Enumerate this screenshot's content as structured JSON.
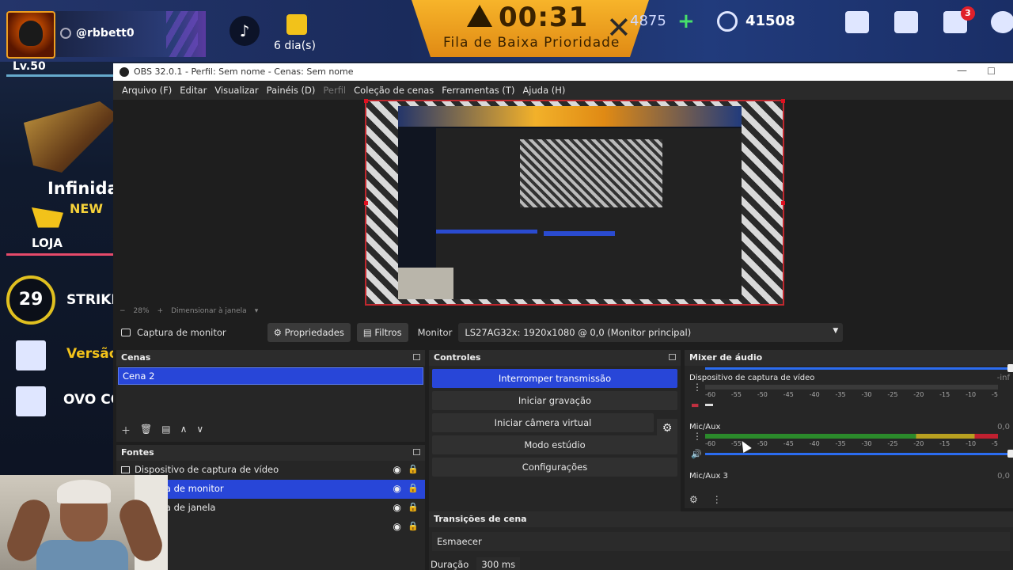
{
  "game": {
    "username": "@rbbett0",
    "level": "Lv.50",
    "days": "6 dia(s)",
    "timer": "00:31",
    "queue_label": "Fila de Baixa Prioridade",
    "diamonds": "4875",
    "coins": "41508",
    "mail_badge": "3",
    "promo_title": "Infinida",
    "new_label": "NEW",
    "shop_label": "LOJA",
    "rank_level": "29",
    "strike_label": "STRIKE",
    "version_label": "Versão",
    "ovo_label": "OVO CO"
  },
  "obs": {
    "title": "OBS 32.0.1 - Perfil: Sem nome - Cenas: Sem nome",
    "menu": [
      "Arquivo (F)",
      "Editar",
      "Visualizar",
      "Painéis (D)",
      "Perfil",
      "Coleção de cenas",
      "Ferramentas (T)",
      "Ajuda (H)"
    ],
    "zoom": "28%",
    "zoom_mode": "Dimensionar à janela",
    "source_bar": {
      "source_name": "Captura de monitor",
      "properties": "Propriedades",
      "filters": "Filtros",
      "monitor_label": "Monitor",
      "monitor_value": "LS27AG32x: 1920x1080 @ 0,0 (Monitor principal)"
    },
    "scenes": {
      "header": "Cenas",
      "items": [
        "Cena 2"
      ]
    },
    "sources": {
      "header": "Fontes",
      "items": [
        "Dispositivo de captura de vídeo",
        "Captura de monitor",
        "Captura de janela",
        ""
      ]
    },
    "controls": {
      "header": "Controles",
      "stop_stream": "Interromper transmissão",
      "start_recording": "Iniciar gravação",
      "virtual_camera": "Iniciar câmera virtual",
      "studio_mode": "Modo estúdio",
      "settings": "Configurações"
    },
    "mixer": {
      "header": "Mixer de áudio",
      "tracks": [
        {
          "name": "Dispositivo de captura de vídeo",
          "db": "-inf",
          "level": 0.0
        },
        {
          "name": "Mic/Aux",
          "db": "0,0",
          "level": 1.0
        },
        {
          "name": "Mic/Aux 3",
          "db": "0,0",
          "level": 0.0
        }
      ],
      "ticks": [
        "-60",
        "-55",
        "-50",
        "-45",
        "-40",
        "-35",
        "-30",
        "-25",
        "-20",
        "-15",
        "-10",
        "-5"
      ]
    },
    "transitions": {
      "header": "Transições de cena",
      "type": "Esmaecer",
      "duration_label": "Duração",
      "duration_value": "300 ms"
    }
  }
}
